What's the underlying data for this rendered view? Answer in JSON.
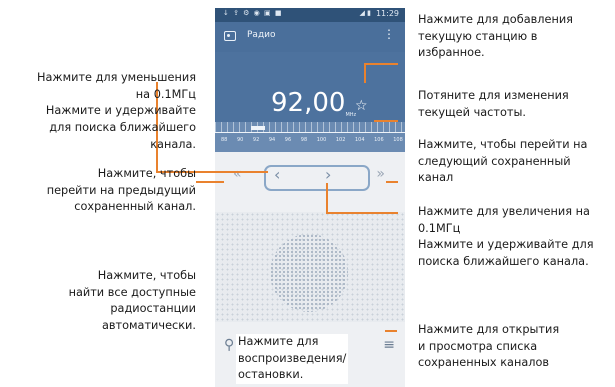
{
  "phone": {
    "status": {
      "time": "11:29",
      "left_icons": "↓ ⇪ ⚙ ◉ ▣ ■",
      "right_icons": "◢ ▮"
    },
    "app_title": "Радио",
    "menu_glyph": "⋮",
    "frequency": "92,00",
    "unit": "MHz",
    "ruler_labels": "88 90 92 94 96 98 100 102 104 106 108",
    "icons": {
      "favorite": "☆",
      "prev_channel": "«",
      "next_channel": "»",
      "step_down": "‹",
      "step_up": "›",
      "search": "⚲",
      "power": "⏻",
      "list": "≡"
    }
  },
  "callouts": {
    "favorite": [
      "Нажмите для добавления",
      "текущую станцию в",
      "избранное."
    ],
    "step_down": [
      "Нажмите для уменьшения",
      "на 0.1МГц",
      "Нажмите и удерживайте",
      "для поиска ближайшего",
      "канала."
    ],
    "drag": [
      "Потяните для изменения",
      "текущей частоты."
    ],
    "next_channel": [
      "Нажмите, чтобы перейти на",
      "следующий сохраненный",
      "канал"
    ],
    "prev_channel": [
      "Нажмите, чтобы",
      "перейти на предыдущий",
      "сохраненный канал."
    ],
    "step_up": [
      "Нажмите для увеличения на",
      "0.1МГц",
      "Нажмите и удерживайте для",
      "поиска ближайшего канала."
    ],
    "search": [
      "Нажмите, чтобы",
      "найти все доступные",
      "радиостанции",
      "автоматически."
    ],
    "list": [
      "Нажмите для открытия",
      "и просмотра списка",
      "сохраненных каналов"
    ],
    "power": [
      "Нажмите для",
      "воспроизведения/",
      "остановки."
    ]
  },
  "colors": {
    "accent_line": "#e9822e",
    "app_blue": "#4a6f9b"
  }
}
